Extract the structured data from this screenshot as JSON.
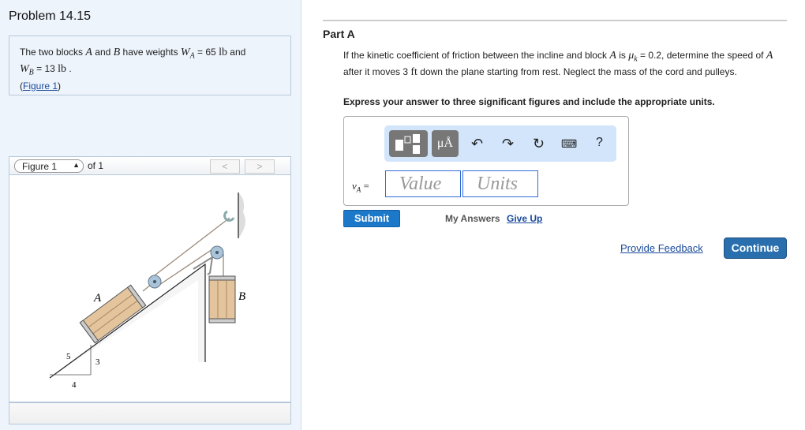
{
  "problem": {
    "title": "Problem 14.15",
    "text_1": "The two blocks ",
    "var_A": "A",
    "text_2": " and ",
    "var_B": "B",
    "text_3": " have weights ",
    "WA": "W",
    "WA_sub": "A",
    "eq_1": " = 65 ",
    "unit_1": "lb",
    "text_4": " and",
    "WB": "W",
    "WB_sub": "B",
    "eq_2": " = 13 ",
    "unit_2": "lb",
    "text_5": " .",
    "figure_link": "Figure 1"
  },
  "figure": {
    "select_value": "Figure 1",
    "of_label": "of 1",
    "prev": "<",
    "next": ">",
    "labels": {
      "A": "A",
      "B": "B",
      "slope_5": "5",
      "slope_3": "3",
      "slope_4": "4"
    }
  },
  "part": {
    "title": "Part A",
    "q1": "If the kinetic coefficient of friction between the incline and block ",
    "qA": "A",
    "q2": " is ",
    "mu": "μ",
    "mu_sub": "k",
    "q3": " = 0.2, determine the speed of ",
    "qA2": "A",
    "q4": " after it moves 3 ",
    "ft": "ft",
    "q5": " down the plane starting from rest. Neglect the mass of the cord and pulleys.",
    "instructions": "Express your answer to three significant figures and include the appropriate units."
  },
  "answer": {
    "var": "v",
    "var_sub": "A",
    "equals": " =",
    "value_placeholder": "Value",
    "units_placeholder": "Units",
    "units_btn": "μÅ",
    "help": "?"
  },
  "actions": {
    "submit": "Submit",
    "my_answers": "My Answers",
    "give_up": "Give Up",
    "feedback": "Provide Feedback",
    "continue": "Continue"
  }
}
